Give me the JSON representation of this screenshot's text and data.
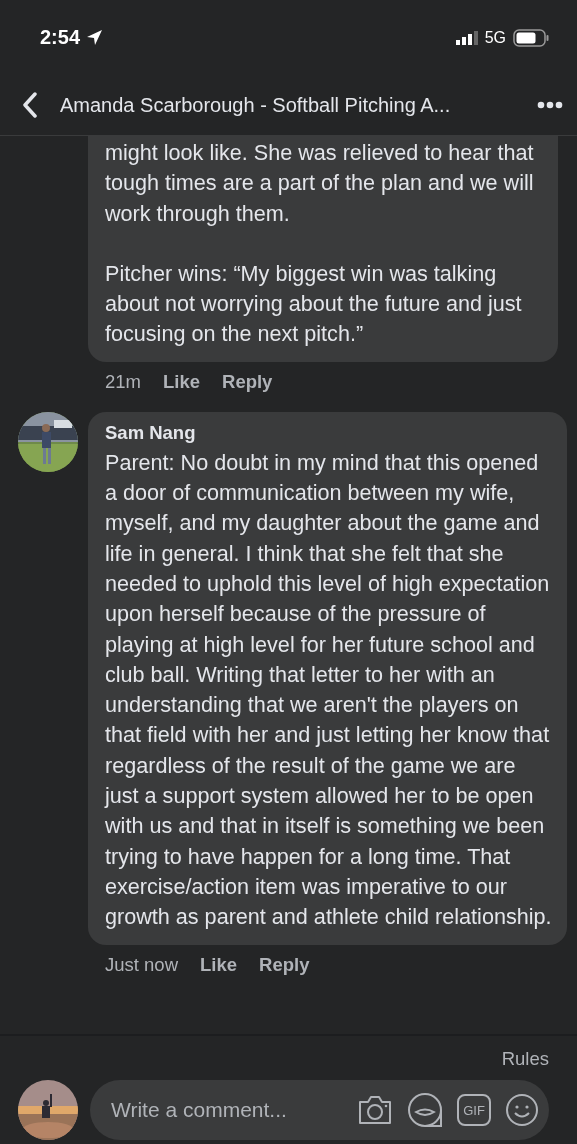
{
  "status_bar": {
    "time": "2:54",
    "network": "5G"
  },
  "header": {
    "title": "Amanda Scarborough - Softball Pitching A..."
  },
  "comments": [
    {
      "paragraphs": [
        "might look like. She was relieved to hear that tough times are a part of the plan and we will work through them.",
        "Pitcher wins: “My biggest win was talking about not worrying about the future and just focusing on the next pitch.”"
      ],
      "time": "21m",
      "actions": [
        "Like",
        "Reply"
      ],
      "cut_top": true
    },
    {
      "author": "Sam Nang",
      "paragraphs": [
        "Parent: No doubt in my mind that this opened a door of communication between my wife, myself, and my daughter about the game and life in general.  I think that she felt that she needed to uphold this level of high expectation upon herself because of the pressure of playing at high level for her future school and club ball. Writing that letter to her with an understanding that we aren't the players on that field with her and just letting her know that regardless of the result of the game we are just a support system allowed her to be open with us and that in itself is something we been trying to have happen for a long time. That exercise/action item was imperative to our growth as parent and athlete child relationship."
      ],
      "time": "Just now",
      "actions": [
        "Like",
        "Reply"
      ],
      "cut_top": false
    }
  ],
  "composer": {
    "rules": "Rules",
    "placeholder": "Write a comment...",
    "gif": "GIF"
  }
}
